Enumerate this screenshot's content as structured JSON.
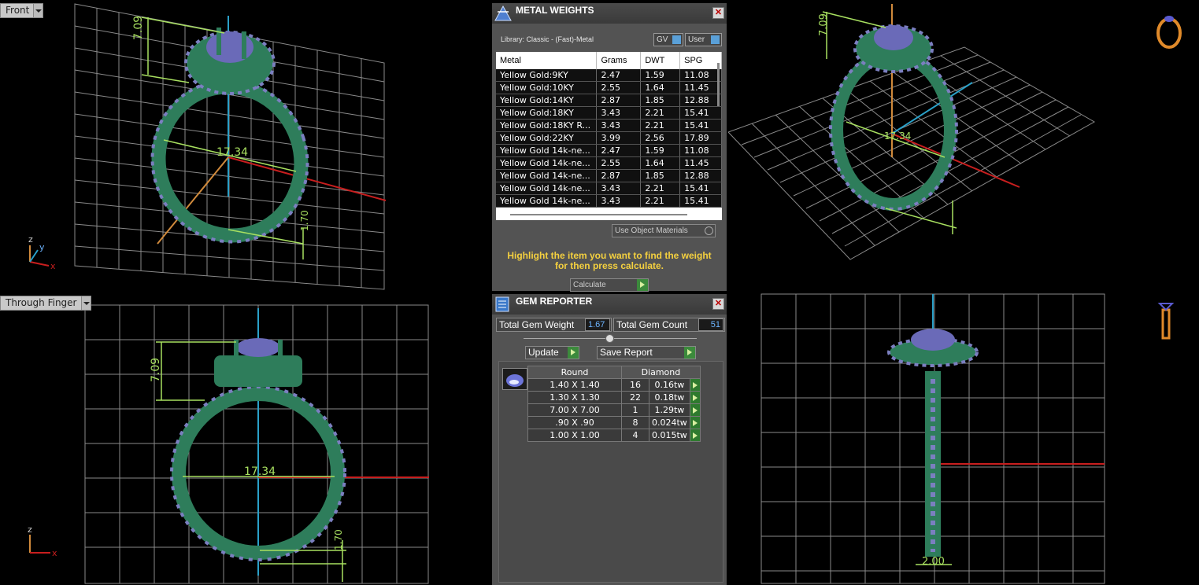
{
  "viewports": {
    "front": {
      "label": "Front"
    },
    "through_finger": {
      "label": "Through Finger"
    }
  },
  "dims": {
    "height": "7.09",
    "width": "17.34",
    "band": "1.70",
    "side": "2.00"
  },
  "axes": {
    "x": "x",
    "y": "y",
    "z": "z"
  },
  "metal_weights": {
    "title": "METAL WEIGHTS",
    "library": "Library: Classic - (Fast)-Metal",
    "gv_label": "GV",
    "user_label": "User",
    "columns": [
      "Metal",
      "Grams",
      "DWT",
      "SPG"
    ],
    "rows": [
      [
        "Yellow Gold:9KY",
        "2.47",
        "1.59",
        "11.08"
      ],
      [
        "Yellow Gold:10KY",
        "2.55",
        "1.64",
        "11.45"
      ],
      [
        "Yellow Gold:14KY",
        "2.87",
        "1.85",
        "12.88"
      ],
      [
        "Yellow Gold:18KY",
        "3.43",
        "2.21",
        "15.41"
      ],
      [
        "Yellow Gold:18KY R...",
        "3.43",
        "2.21",
        "15.41"
      ],
      [
        "Yellow Gold:22KY",
        "3.99",
        "2.56",
        "17.89"
      ],
      [
        "Yellow Gold 14k-ne...",
        "2.47",
        "1.59",
        "11.08"
      ],
      [
        "Yellow Gold 14k-ne...",
        "2.55",
        "1.64",
        "11.45"
      ],
      [
        "Yellow Gold 14k-ne...",
        "2.87",
        "1.85",
        "12.88"
      ],
      [
        "Yellow Gold 14k-ne...",
        "3.43",
        "2.21",
        "15.41"
      ],
      [
        "Yellow Gold 14k-ne...",
        "3.43",
        "2.21",
        "15.41"
      ]
    ],
    "use_object_materials": "Use Object Materials",
    "hint_line1": "Highlight the item you want to find the weight",
    "hint_line2": "for then press calculate.",
    "calculate": "Calculate"
  },
  "gem_reporter": {
    "title": "GEM REPORTER",
    "total_weight_label": "Total Gem Weight",
    "total_weight_value": "1.67",
    "total_count_label": "Total Gem Count",
    "total_count_value": "51",
    "update": "Update",
    "save_report": "Save Report",
    "table_head": [
      "Round",
      "Diamond"
    ],
    "rows": [
      [
        "1.40 X 1.40",
        "16",
        "0.16tw"
      ],
      [
        "1.30 X 1.30",
        "22",
        "0.18tw"
      ],
      [
        "7.00 X 7.00",
        "1",
        "1.29tw"
      ],
      [
        ".90 X .90",
        "8",
        "0.024tw"
      ],
      [
        "1.00 X 1.00",
        "4",
        "0.015tw"
      ]
    ]
  },
  "colors": {
    "ring_green": "#2e7d5b",
    "stone_blue": "#7b7fc0",
    "grid": "#8a8a8a",
    "dim_green": "#a8e060",
    "axis_red": "#c81e1e",
    "axis_cyan": "#2aa0c8",
    "axis_orange": "#d08a3c"
  }
}
